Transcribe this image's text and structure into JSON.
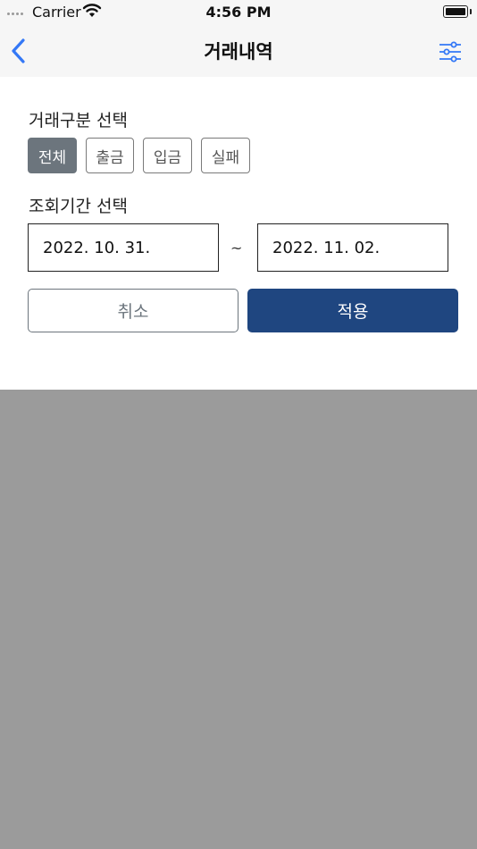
{
  "status_bar": {
    "carrier": "Carrier",
    "time": "4:56 PM"
  },
  "nav": {
    "title": "거래내역",
    "back_icon": "chevron-left-icon",
    "filter_icon": "sliders-icon",
    "accent_color": "#3478f6"
  },
  "filter_panel": {
    "type_label": "거래구분 선택",
    "types": [
      {
        "label": "전체",
        "selected": true
      },
      {
        "label": "출금",
        "selected": false
      },
      {
        "label": "입금",
        "selected": false
      },
      {
        "label": "실패",
        "selected": false
      }
    ],
    "period_label": "조회기간 선택",
    "start_date": "2022. 10. 31.",
    "separator": "~",
    "end_date": "2022. 11. 02.",
    "cancel_label": "취소",
    "apply_label": "적용",
    "apply_color": "#1f4680",
    "selected_color": "#6c757d"
  }
}
